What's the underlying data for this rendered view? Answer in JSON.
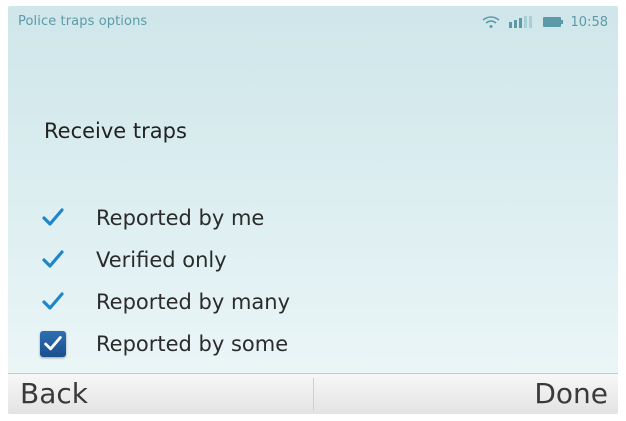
{
  "status_bar": {
    "title": "Police traps options",
    "time": "10:58",
    "icons": [
      "wifi-icon",
      "signal-icon",
      "battery-icon"
    ]
  },
  "section": {
    "title": "Receive traps"
  },
  "options": [
    {
      "label": "Reported by me",
      "checked": true,
      "style": "plain"
    },
    {
      "label": "Verified only",
      "checked": true,
      "style": "plain"
    },
    {
      "label": "Reported by many",
      "checked": true,
      "style": "plain"
    },
    {
      "label": "Reported by some",
      "checked": true,
      "style": "focused"
    }
  ],
  "softkeys": {
    "left": "Back",
    "right": "Done"
  },
  "colors": {
    "accent": "#1f86c9",
    "focus_box": "#1b4f8d",
    "status_text": "#5d9aa7"
  }
}
